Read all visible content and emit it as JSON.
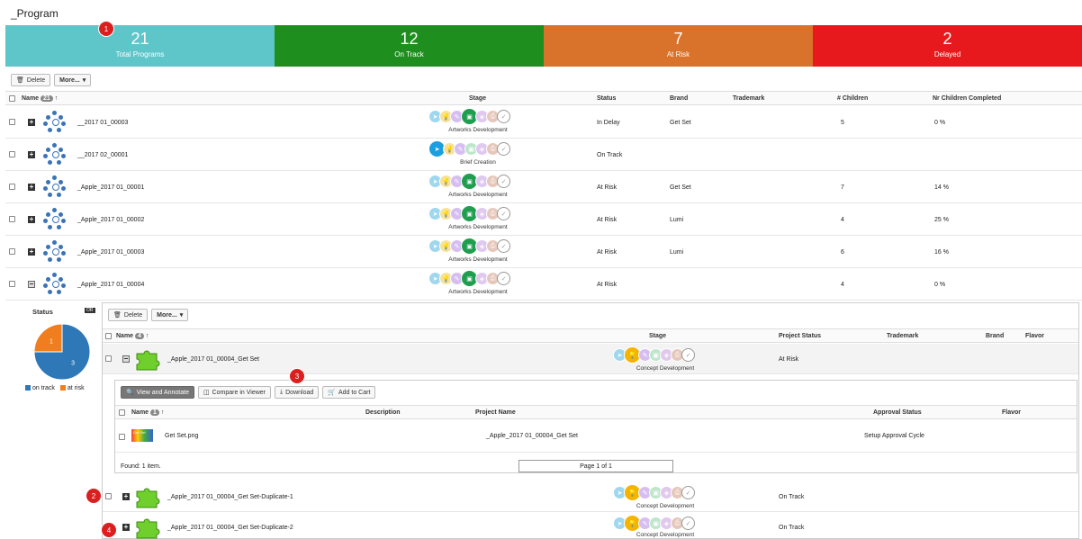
{
  "page": {
    "title": "_Program"
  },
  "kpis": [
    {
      "value": "21",
      "label": "Total Programs",
      "color": "#5ec5c9"
    },
    {
      "value": "12",
      "label": "On Track",
      "color": "#1e8e1e"
    },
    {
      "value": "7",
      "label": "At Risk",
      "color": "#d9722a"
    },
    {
      "value": "2",
      "label": "Delayed",
      "color": "#e8191c"
    }
  ],
  "toolbar": {
    "delete_label": "Delete",
    "more_label": "More..."
  },
  "columns": {
    "name": "Name",
    "name_count": "21",
    "stage": "Stage",
    "status": "Status",
    "brand": "Brand",
    "trademark": "Trademark",
    "children": "# Children",
    "completed": "Nr Children Completed"
  },
  "programs": [
    {
      "name": "__2017 01_00003",
      "stage": "Artworks Development",
      "status": "In Delay",
      "brand": "Get Set",
      "children": "5",
      "completed": "0 %"
    },
    {
      "name": "__2017 02_00001",
      "stage": "Brief Creation",
      "status": "On Track",
      "brand": "",
      "children": "",
      "completed": ""
    },
    {
      "name": "_Apple_2017 01_00001",
      "stage": "Artworks Development",
      "status": "At Risk",
      "brand": "Get Set",
      "children": "7",
      "completed": "14 %"
    },
    {
      "name": "_Apple_2017 01_00002",
      "stage": "Artworks Development",
      "status": "At Risk",
      "brand": "Lumi",
      "children": "4",
      "completed": "25 %"
    },
    {
      "name": "_Apple_2017 01_00003",
      "stage": "Artworks Development",
      "status": "At Risk",
      "brand": "Lumi",
      "children": "6",
      "completed": "16 %"
    },
    {
      "name": "_Apple_2017 01_00004",
      "stage": "Artworks Development",
      "status": "At Risk",
      "brand": "",
      "children": "4",
      "completed": "0 %"
    }
  ],
  "status_panel": {
    "title": "Status",
    "tag": "OR",
    "legend": [
      {
        "label": "on track",
        "color": "#2e78b8"
      },
      {
        "label": "at risk",
        "color": "#f07e1e"
      }
    ]
  },
  "chart_data": {
    "type": "pie",
    "title": "Status",
    "categories": [
      "on track",
      "at risk"
    ],
    "values": [
      3,
      1
    ],
    "colors": [
      "#2e78b8",
      "#f07e1e"
    ]
  },
  "sub": {
    "columns": {
      "name": "Name",
      "name_count": "4",
      "stage": "Stage",
      "project_status": "Project Status",
      "trademark": "Trademark",
      "brand": "Brand",
      "flavor": "Flavor"
    },
    "projects": [
      {
        "name": "_Apple_2017 01_00004_Get Set",
        "stage": "Concept Development",
        "status": "At Risk"
      },
      {
        "name": "_Apple_2017 01_00004_Get Set-Duplicate-1",
        "stage": "Concept Development",
        "status": "On Track"
      },
      {
        "name": "_Apple_2017 01_00004_Get Set-Duplicate-2",
        "stage": "Concept Development",
        "status": "On Track"
      }
    ]
  },
  "files": {
    "view_label": "View and Annotate",
    "compare_label": "Compare in Viewer",
    "download_label": "Download",
    "cart_label": "Add to Cart",
    "columns": {
      "name": "Name",
      "name_count": "1",
      "description": "Description",
      "project_name": "Project Name",
      "approval": "Approval Status",
      "flavor": "Flavor"
    },
    "row": {
      "name": "Get Set.png",
      "thumb_text": "Get Set",
      "project": "_Apple_2017 01_00004_Get Set",
      "approval": "Setup Approval Cycle"
    },
    "found": "Found: 1 item.",
    "pager": "Page 1 of 1"
  },
  "badges": [
    "1",
    "2",
    "3",
    "4"
  ]
}
